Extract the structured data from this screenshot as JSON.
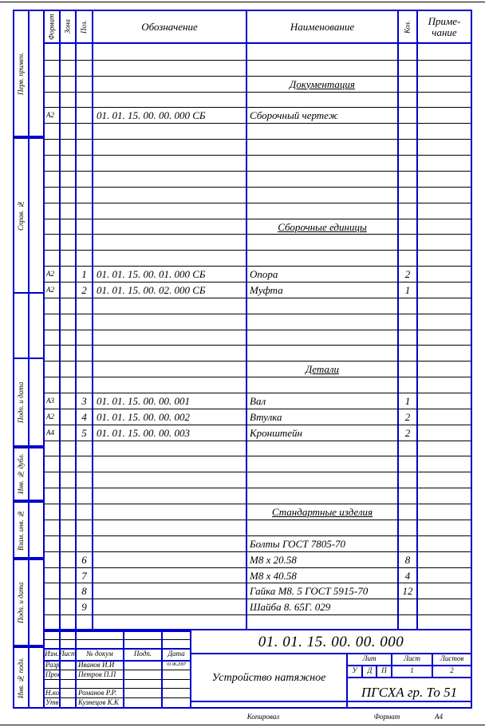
{
  "document": {
    "type": "GOST specification form",
    "sheet_format": "A4"
  },
  "columns": {
    "format": "Формат",
    "zone": "Зона",
    "pos": "Поз.",
    "designation": "Обозначение",
    "name": "Наименование",
    "qty": "Кол.",
    "note_line1": "Приме-",
    "note_line2": "чание"
  },
  "side_labels": {
    "first_use": "Перв. примен.",
    "ref_no": "Справ. №",
    "sign_date_1": "Подп. и дата",
    "inv_dubl": "Инв. № дубл.",
    "vzam_inv": "Взам. инв. №",
    "sign_date_2": "Подп. и дата",
    "inv_podl": "Инв. № подл."
  },
  "sections": [
    {
      "row": 2,
      "title": "Документация"
    },
    {
      "row": 11,
      "title": "Сборочные единицы"
    },
    {
      "row": 20,
      "title": "Детали"
    },
    {
      "row": 29,
      "title": "Стандартные изделия"
    }
  ],
  "rows": [
    {
      "row": 4,
      "format": "А2",
      "zone": "",
      "pos": "",
      "designation": "01. 01. 15. 00. 00. 000 СБ",
      "name": "Сборочный чертеж",
      "qty": "",
      "note": ""
    },
    {
      "row": 14,
      "format": "А2",
      "zone": "",
      "pos": "1",
      "designation": "01. 01. 15. 00. 01. 000 СБ",
      "name": "Опора",
      "qty": "2",
      "note": ""
    },
    {
      "row": 15,
      "format": "А2",
      "zone": "",
      "pos": "2",
      "designation": "01. 01. 15. 00. 02. 000 СБ",
      "name": "Муфта",
      "qty": "1",
      "note": ""
    },
    {
      "row": 22,
      "format": "А3",
      "zone": "",
      "pos": "3",
      "designation": "01. 01. 15. 00. 00. 001",
      "name": "Вал",
      "qty": "1",
      "note": ""
    },
    {
      "row": 23,
      "format": "А2",
      "zone": "",
      "pos": "4",
      "designation": "01. 01. 15. 00. 00. 002",
      "name": "Втулка",
      "qty": "2",
      "note": ""
    },
    {
      "row": 24,
      "format": "А4",
      "zone": "",
      "pos": "5",
      "designation": "01. 01. 15. 00. 00. 003",
      "name": "Кронштейн",
      "qty": "2",
      "note": ""
    },
    {
      "row": 31,
      "format": "",
      "zone": "",
      "pos": "",
      "designation": "",
      "name": "Болты ГОСТ 7805-70",
      "qty": "",
      "note": ""
    },
    {
      "row": 32,
      "format": "",
      "zone": "",
      "pos": "6",
      "designation": "",
      "name": "М8 х 20.58",
      "qty": "8",
      "note": ""
    },
    {
      "row": 33,
      "format": "",
      "zone": "",
      "pos": "7",
      "designation": "",
      "name": "М8 х 40.58",
      "qty": "4",
      "note": ""
    },
    {
      "row": 34,
      "format": "",
      "zone": "",
      "pos": "8",
      "designation": "",
      "name": "Гайка М8. 5 ГОСТ 5915-70",
      "qty": "12",
      "note": ""
    },
    {
      "row": 35,
      "format": "",
      "zone": "",
      "pos": "9",
      "designation": "",
      "name": "Шайба 8. 65Г. 029",
      "qty": "",
      "note": ""
    }
  ],
  "title_block": {
    "rev_headers": {
      "izm": "Изм.",
      "list": "Лист",
      "ndocum": "№ докум",
      "podp": "Подп.",
      "data": "Дата"
    },
    "rev_rows": [
      {
        "role": "Разраб.",
        "person": "Иванов И.И",
        "podp": "",
        "data": "01.06.2007"
      },
      {
        "role": "Пров.",
        "person": "Петров П.П",
        "podp": "",
        "data": ""
      },
      {
        "role": "",
        "person": "",
        "podp": "",
        "data": ""
      },
      {
        "role": "Н.контр.",
        "person": "Романов Р.Р.",
        "podp": "",
        "data": ""
      },
      {
        "role": "Утв.",
        "person": "Кузнецов К.К",
        "podp": "",
        "data": ""
      }
    ],
    "code": "01. 01. 15. 00. 00. 000",
    "product_name": "Устройство натяжное",
    "lit_header": "Лит",
    "list_header": "Лист",
    "listov_header": "Листов",
    "lit_a": "У",
    "lit_b": "Д",
    "lit_c": "П",
    "list_value": "1",
    "listov_value": "2",
    "organization": "ПГСХА гр. То 51"
  },
  "footer": {
    "copied": "Копировал",
    "format_label": "Формат",
    "format_value": "А4"
  },
  "colors": {
    "frame": "#0000cc",
    "inner_line": "#000000",
    "text": "#000000",
    "background": "#ffffff"
  }
}
